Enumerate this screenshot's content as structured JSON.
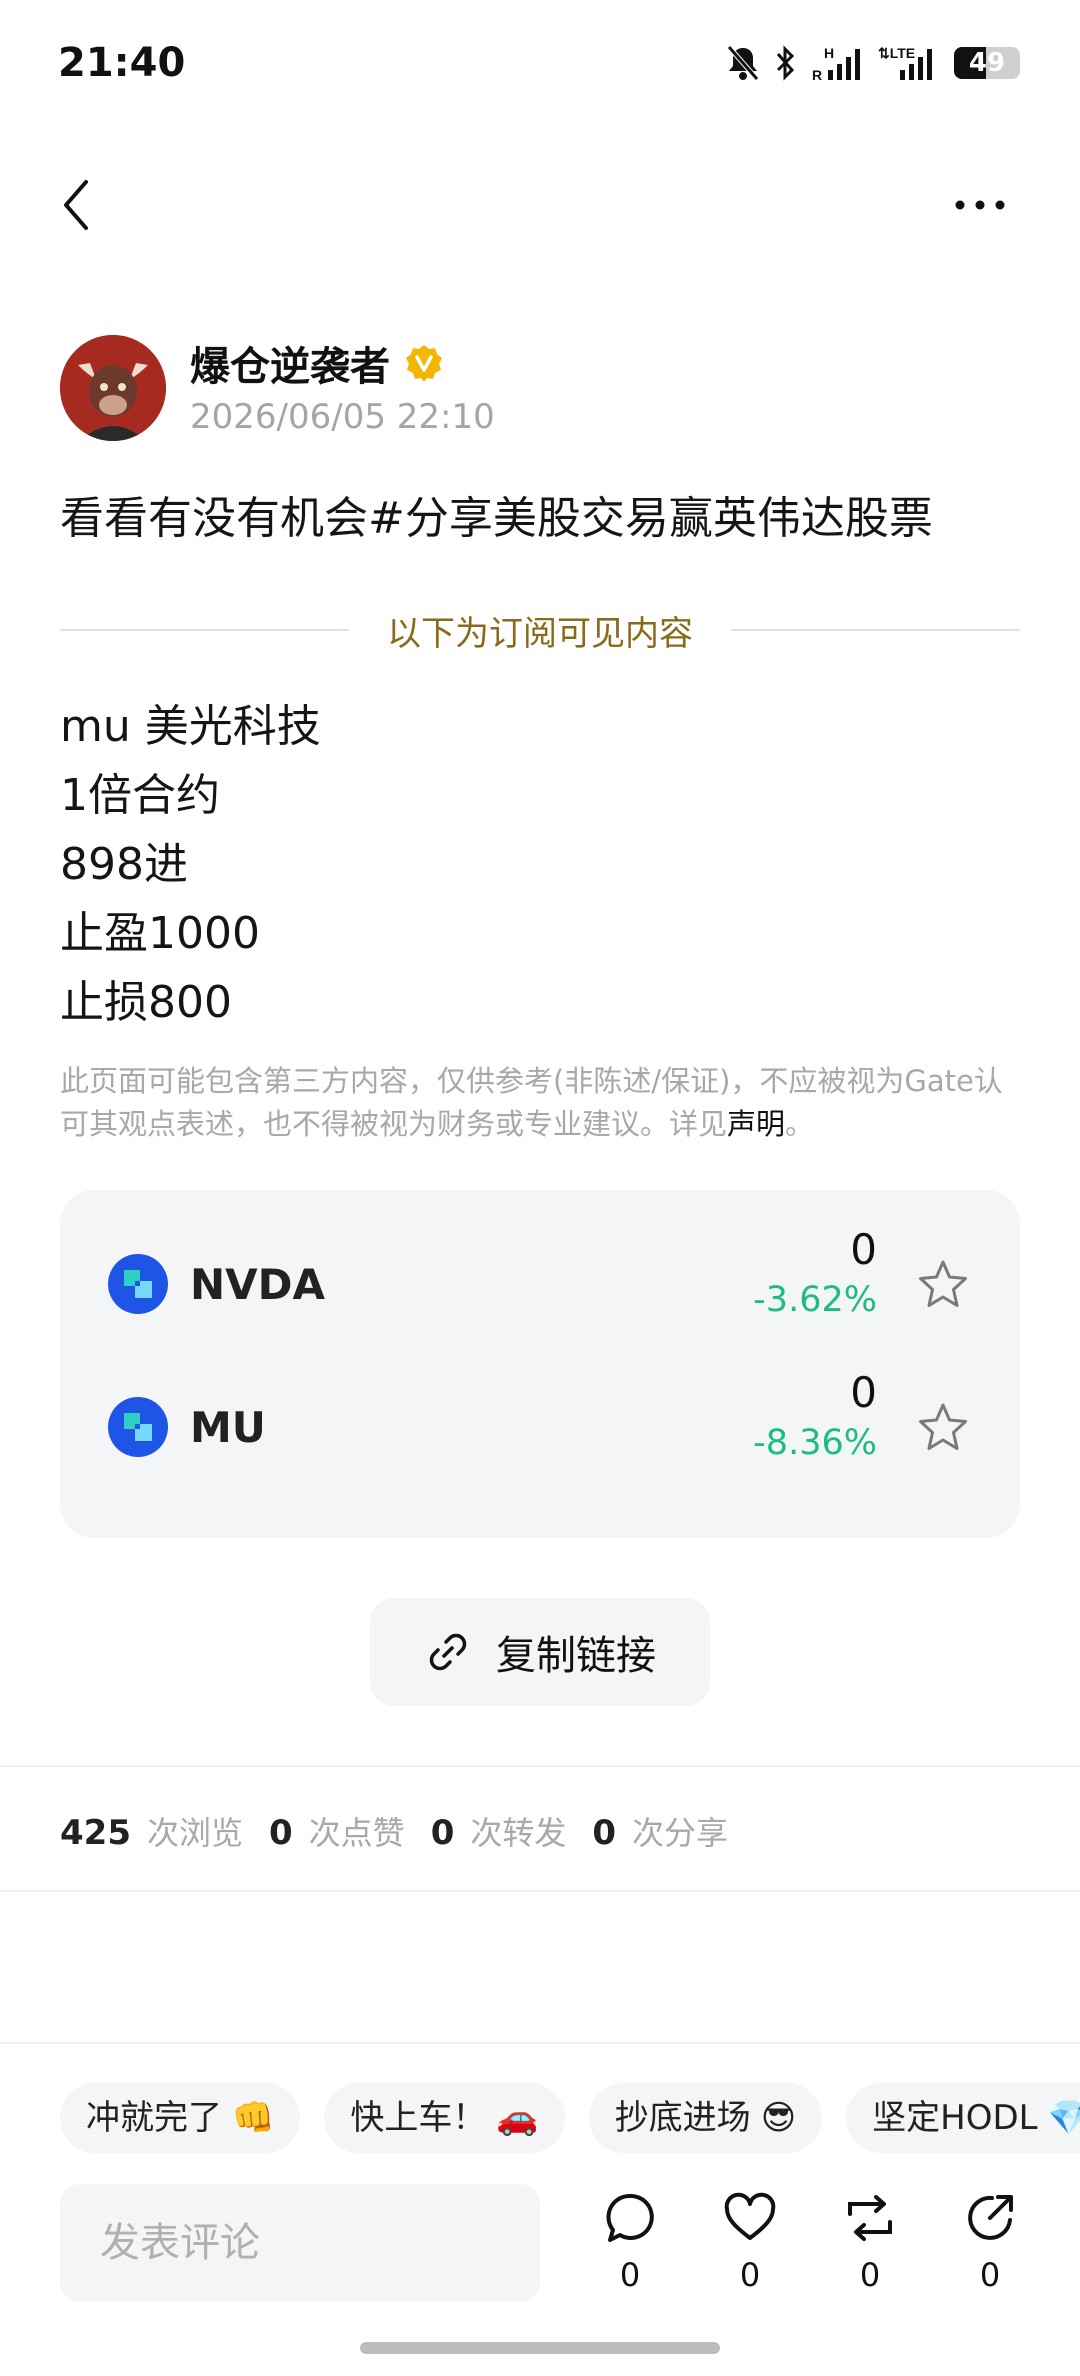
{
  "status_bar": {
    "time": "21:40",
    "battery_level": "49"
  },
  "author": {
    "name": "爆仓逆袭者",
    "timestamp": "2026/06/05 22:10",
    "verified": true
  },
  "post": {
    "title": "看看有没有机会#分享美股交易赢英伟达股票",
    "divider_text": "以下为订阅可见内容",
    "lines": [
      "mu 美光科技",
      "1倍合约",
      "898进",
      "止盈1000",
      "止损800"
    ],
    "disclaimer_text": "此页面可能包含第三方内容，仅供参考(非陈述/保证)，不应被视为Gate认可其观点表述，也不得被视为财务或专业建议。详见",
    "disclaimer_link": "声明",
    "disclaimer_end": "。"
  },
  "stocks": [
    {
      "symbol": "NVDA",
      "price": "0",
      "change": "-3.62%"
    },
    {
      "symbol": "MU",
      "price": "0",
      "change": "-8.36%"
    }
  ],
  "copy_link_label": "复制链接",
  "stats": [
    {
      "value": "425",
      "label": "次浏览"
    },
    {
      "value": "0",
      "label": "次点赞"
    },
    {
      "value": "0",
      "label": "次转发"
    },
    {
      "value": "0",
      "label": "次分享"
    }
  ],
  "quick_replies": [
    {
      "text": "冲就完了",
      "emoji": "👊"
    },
    {
      "text": "快上车！",
      "emoji": "🚗"
    },
    {
      "text": "抄底进场",
      "emoji": "😎"
    },
    {
      "text": "坚定HODL",
      "emoji": "💎"
    }
  ],
  "comment_placeholder": "发表评论",
  "actions": [
    {
      "icon": "comment-icon",
      "count": "0"
    },
    {
      "icon": "heart-icon",
      "count": "0"
    },
    {
      "icon": "repost-icon",
      "count": "0"
    },
    {
      "icon": "share-icon",
      "count": "0"
    }
  ],
  "colors": {
    "positive": "#1dbd7f",
    "accent_gold": "#8a6a1a",
    "verified": "#f2b705"
  }
}
